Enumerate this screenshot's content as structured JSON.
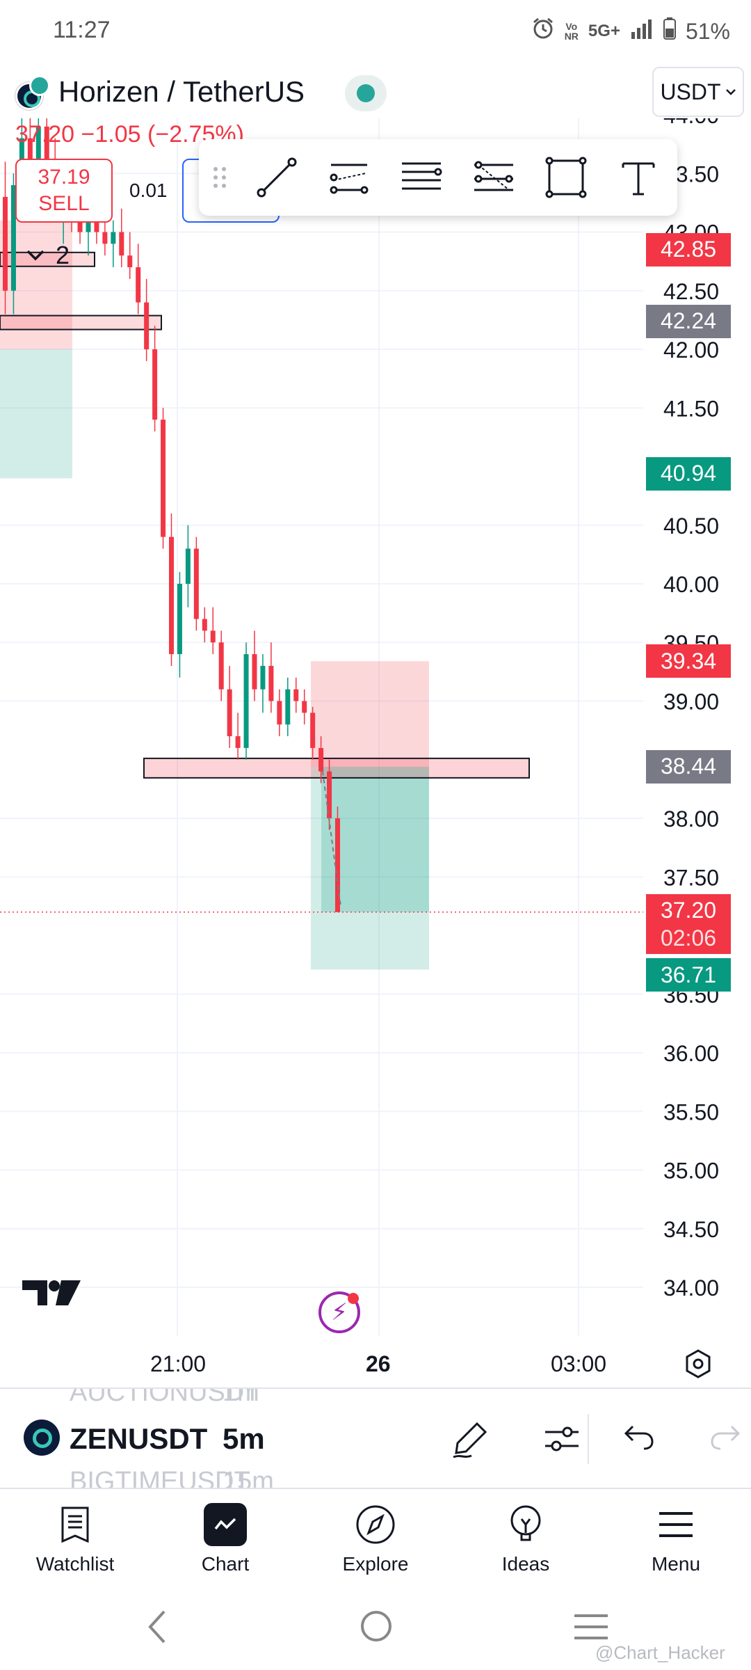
{
  "status": {
    "time": "11:27",
    "network_vo": "Vo",
    "network_nr": "NR",
    "network": "5G+",
    "battery": "51%"
  },
  "header": {
    "title": "Horizen / TetherUS",
    "currency": "USDT",
    "price": "37.20",
    "change": "−1.05 (−2.75%)"
  },
  "trade": {
    "sell_price": "37.19",
    "sell_label": "SELL",
    "spread": "0.01",
    "collapse_count": "2"
  },
  "price_axis": {
    "ticks": [
      "44.00",
      "43.50",
      "43.00",
      "42.50",
      "42.00",
      "41.50",
      "40.50",
      "40.00",
      "39.50",
      "39.00",
      "38.00",
      "37.50",
      "36.50",
      "36.00",
      "35.50",
      "35.00",
      "34.50",
      "34.00"
    ],
    "tags": [
      {
        "value": "42.85",
        "color": "#f23645"
      },
      {
        "value": "42.24",
        "color": "#787b86"
      },
      {
        "value": "40.94",
        "color": "#089981"
      },
      {
        "value": "39.34",
        "color": "#f23645"
      },
      {
        "value": "38.44",
        "color": "#787b86"
      },
      {
        "value": "37.20",
        "color": "#f23645"
      },
      {
        "value": "36.71",
        "color": "#089981"
      }
    ],
    "countdown": "02:06"
  },
  "time_axis": {
    "labels": [
      "21:00",
      "26",
      "03:00"
    ]
  },
  "toolbar": {
    "symbol": "ZENUSDT",
    "interval": "5m",
    "above_symbol": "AUCTIONUSDT",
    "above_interval": "1m",
    "below_symbol": "BIGTIMEUSDT",
    "below_interval": "15m"
  },
  "nav": {
    "items": [
      {
        "label": "Watchlist",
        "icon": "watchlist-icon"
      },
      {
        "label": "Chart",
        "icon": "chart-icon"
      },
      {
        "label": "Explore",
        "icon": "compass-icon"
      },
      {
        "label": "Ideas",
        "icon": "lightbulb-icon"
      },
      {
        "label": "Menu",
        "icon": "menu-icon"
      }
    ]
  },
  "watermark": "@Chart_Hacker",
  "chart_data": {
    "type": "candlestick",
    "ylim": [
      33.8,
      44.2
    ],
    "colors": {
      "up": "#089981",
      "down": "#f23645"
    },
    "candles": [
      [
        43.3,
        43.6,
        42.3,
        42.5
      ],
      [
        42.5,
        43.5,
        42.3,
        43.4
      ],
      [
        43.4,
        44.0,
        43.2,
        43.8
      ],
      [
        43.8,
        44.1,
        43.5,
        43.6
      ],
      [
        43.6,
        44.1,
        43.4,
        43.9
      ],
      [
        43.9,
        44.1,
        43.4,
        43.5
      ],
      [
        43.5,
        43.8,
        43.1,
        43.2
      ],
      [
        43.2,
        43.5,
        42.9,
        43.3
      ],
      [
        43.3,
        43.6,
        43.0,
        43.1
      ],
      [
        43.1,
        43.4,
        42.9,
        43.0
      ],
      [
        43.0,
        43.3,
        42.8,
        43.2
      ],
      [
        43.2,
        43.4,
        42.9,
        43.0
      ],
      [
        43.0,
        43.2,
        42.8,
        42.9
      ],
      [
        42.9,
        43.1,
        42.7,
        43.0
      ],
      [
        43.0,
        43.2,
        42.7,
        42.8
      ],
      [
        42.8,
        43.0,
        42.6,
        42.7
      ],
      [
        42.7,
        42.9,
        42.3,
        42.4
      ],
      [
        42.4,
        42.6,
        41.9,
        42.0
      ],
      [
        42.0,
        42.2,
        41.3,
        41.4
      ],
      [
        41.4,
        41.5,
        40.3,
        40.4
      ],
      [
        40.4,
        40.6,
        39.3,
        39.4
      ],
      [
        39.4,
        40.1,
        39.2,
        40.0
      ],
      [
        40.0,
        40.5,
        39.8,
        40.3
      ],
      [
        40.3,
        40.4,
        39.6,
        39.7
      ],
      [
        39.7,
        39.8,
        39.5,
        39.6
      ],
      [
        39.6,
        39.8,
        39.4,
        39.5
      ],
      [
        39.5,
        39.6,
        39.0,
        39.1
      ],
      [
        39.1,
        39.3,
        38.6,
        38.7
      ],
      [
        38.7,
        38.9,
        38.5,
        38.6
      ],
      [
        38.6,
        39.5,
        38.5,
        39.4
      ],
      [
        39.4,
        39.6,
        39.0,
        39.1
      ],
      [
        39.1,
        39.4,
        38.9,
        39.3
      ],
      [
        39.3,
        39.5,
        38.9,
        39.0
      ],
      [
        39.0,
        39.1,
        38.7,
        38.8
      ],
      [
        38.8,
        39.2,
        38.7,
        39.1
      ],
      [
        39.1,
        39.2,
        38.9,
        39.0
      ],
      [
        39.0,
        39.1,
        38.8,
        38.9
      ],
      [
        38.9,
        38.95,
        38.5,
        38.6
      ],
      [
        38.6,
        38.7,
        38.3,
        38.4
      ],
      [
        38.4,
        38.5,
        37.9,
        38.0
      ],
      [
        38.0,
        38.1,
        37.2,
        37.2
      ]
    ]
  }
}
